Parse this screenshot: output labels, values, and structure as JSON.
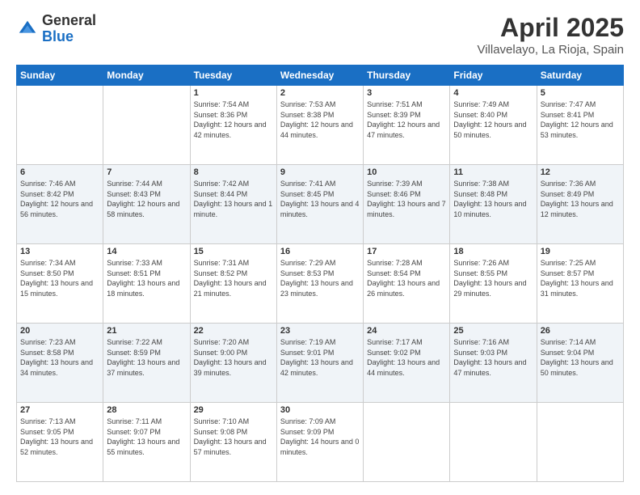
{
  "logo": {
    "general": "General",
    "blue": "Blue"
  },
  "title": {
    "month": "April 2025",
    "location": "Villavelayo, La Rioja, Spain"
  },
  "weekdays": [
    "Sunday",
    "Monday",
    "Tuesday",
    "Wednesday",
    "Thursday",
    "Friday",
    "Saturday"
  ],
  "weeks": [
    [
      {
        "day": null
      },
      {
        "day": null
      },
      {
        "day": "1",
        "sunrise": "7:54 AM",
        "sunset": "8:36 PM",
        "daylight": "12 hours and 42 minutes."
      },
      {
        "day": "2",
        "sunrise": "7:53 AM",
        "sunset": "8:38 PM",
        "daylight": "12 hours and 44 minutes."
      },
      {
        "day": "3",
        "sunrise": "7:51 AM",
        "sunset": "8:39 PM",
        "daylight": "12 hours and 47 minutes."
      },
      {
        "day": "4",
        "sunrise": "7:49 AM",
        "sunset": "8:40 PM",
        "daylight": "12 hours and 50 minutes."
      },
      {
        "day": "5",
        "sunrise": "7:47 AM",
        "sunset": "8:41 PM",
        "daylight": "12 hours and 53 minutes."
      }
    ],
    [
      {
        "day": "6",
        "sunrise": "7:46 AM",
        "sunset": "8:42 PM",
        "daylight": "12 hours and 56 minutes."
      },
      {
        "day": "7",
        "sunrise": "7:44 AM",
        "sunset": "8:43 PM",
        "daylight": "12 hours and 58 minutes."
      },
      {
        "day": "8",
        "sunrise": "7:42 AM",
        "sunset": "8:44 PM",
        "daylight": "13 hours and 1 minute."
      },
      {
        "day": "9",
        "sunrise": "7:41 AM",
        "sunset": "8:45 PM",
        "daylight": "13 hours and 4 minutes."
      },
      {
        "day": "10",
        "sunrise": "7:39 AM",
        "sunset": "8:46 PM",
        "daylight": "13 hours and 7 minutes."
      },
      {
        "day": "11",
        "sunrise": "7:38 AM",
        "sunset": "8:48 PM",
        "daylight": "13 hours and 10 minutes."
      },
      {
        "day": "12",
        "sunrise": "7:36 AM",
        "sunset": "8:49 PM",
        "daylight": "13 hours and 12 minutes."
      }
    ],
    [
      {
        "day": "13",
        "sunrise": "7:34 AM",
        "sunset": "8:50 PM",
        "daylight": "13 hours and 15 minutes."
      },
      {
        "day": "14",
        "sunrise": "7:33 AM",
        "sunset": "8:51 PM",
        "daylight": "13 hours and 18 minutes."
      },
      {
        "day": "15",
        "sunrise": "7:31 AM",
        "sunset": "8:52 PM",
        "daylight": "13 hours and 21 minutes."
      },
      {
        "day": "16",
        "sunrise": "7:29 AM",
        "sunset": "8:53 PM",
        "daylight": "13 hours and 23 minutes."
      },
      {
        "day": "17",
        "sunrise": "7:28 AM",
        "sunset": "8:54 PM",
        "daylight": "13 hours and 26 minutes."
      },
      {
        "day": "18",
        "sunrise": "7:26 AM",
        "sunset": "8:55 PM",
        "daylight": "13 hours and 29 minutes."
      },
      {
        "day": "19",
        "sunrise": "7:25 AM",
        "sunset": "8:57 PM",
        "daylight": "13 hours and 31 minutes."
      }
    ],
    [
      {
        "day": "20",
        "sunrise": "7:23 AM",
        "sunset": "8:58 PM",
        "daylight": "13 hours and 34 minutes."
      },
      {
        "day": "21",
        "sunrise": "7:22 AM",
        "sunset": "8:59 PM",
        "daylight": "13 hours and 37 minutes."
      },
      {
        "day": "22",
        "sunrise": "7:20 AM",
        "sunset": "9:00 PM",
        "daylight": "13 hours and 39 minutes."
      },
      {
        "day": "23",
        "sunrise": "7:19 AM",
        "sunset": "9:01 PM",
        "daylight": "13 hours and 42 minutes."
      },
      {
        "day": "24",
        "sunrise": "7:17 AM",
        "sunset": "9:02 PM",
        "daylight": "13 hours and 44 minutes."
      },
      {
        "day": "25",
        "sunrise": "7:16 AM",
        "sunset": "9:03 PM",
        "daylight": "13 hours and 47 minutes."
      },
      {
        "day": "26",
        "sunrise": "7:14 AM",
        "sunset": "9:04 PM",
        "daylight": "13 hours and 50 minutes."
      }
    ],
    [
      {
        "day": "27",
        "sunrise": "7:13 AM",
        "sunset": "9:05 PM",
        "daylight": "13 hours and 52 minutes."
      },
      {
        "day": "28",
        "sunrise": "7:11 AM",
        "sunset": "9:07 PM",
        "daylight": "13 hours and 55 minutes."
      },
      {
        "day": "29",
        "sunrise": "7:10 AM",
        "sunset": "9:08 PM",
        "daylight": "13 hours and 57 minutes."
      },
      {
        "day": "30",
        "sunrise": "7:09 AM",
        "sunset": "9:09 PM",
        "daylight": "14 hours and 0 minutes."
      },
      {
        "day": null
      },
      {
        "day": null
      },
      {
        "day": null
      }
    ]
  ],
  "labels": {
    "sunrise": "Sunrise:",
    "sunset": "Sunset:",
    "daylight": "Daylight:"
  }
}
